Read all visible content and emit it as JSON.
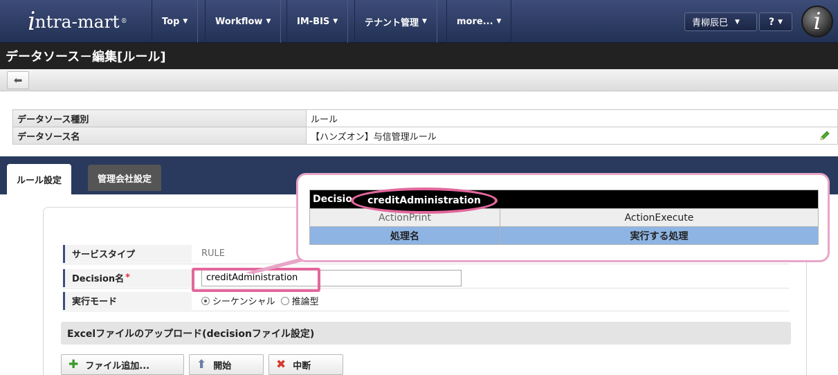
{
  "nav": {
    "logo": "ntra-mart",
    "logo_i": "i",
    "logo_reg": "®",
    "items": [
      {
        "label": "Top"
      },
      {
        "label": "Workflow"
      },
      {
        "label": "IM-BIS"
      },
      {
        "label": "テナント管理"
      },
      {
        "label": "more..."
      }
    ],
    "user": "青柳辰巳",
    "help": "?",
    "avatar_letter": "i"
  },
  "page": {
    "title": "データソース－編集[ルール]"
  },
  "info": {
    "rows": [
      {
        "label": "データソース種別",
        "value": "ルール"
      },
      {
        "label": "データソース名",
        "value": "【ハンズオン】与信管理ルール"
      }
    ]
  },
  "tabs": [
    {
      "label": "ルール設定",
      "active": true
    },
    {
      "label": "管理会社設定",
      "active": false
    }
  ],
  "form": {
    "service_type_label": "サービスタイプ",
    "service_type_value": "RULE",
    "decision_label": "Decision名",
    "decision_required": "*",
    "decision_value": "creditAdministration",
    "mode_label": "実行モード",
    "mode_options": [
      {
        "label": "シーケンシャル",
        "selected": true
      },
      {
        "label": "推論型",
        "selected": false
      }
    ],
    "upload_section": "Excelファイルのアップロード(decisionファイル設定)",
    "buttons": {
      "add": "ファイル追加...",
      "start": "開始",
      "stop": "中断"
    }
  },
  "callout": {
    "header_prefix": "Decisio",
    "decision_name": "creditAdministration",
    "row1_left": "ActionPrint",
    "row1_right": "ActionExecute",
    "row2_left": "処理名",
    "row2_right": "実行する処理"
  },
  "colors": {
    "nav_bg": "#2a3a62",
    "title_bg": "#222222",
    "tab_band": "#293a5e",
    "highlight": "#e2679c",
    "callout_border": "#e7a6c7",
    "header_blue": "#8db4e3"
  }
}
